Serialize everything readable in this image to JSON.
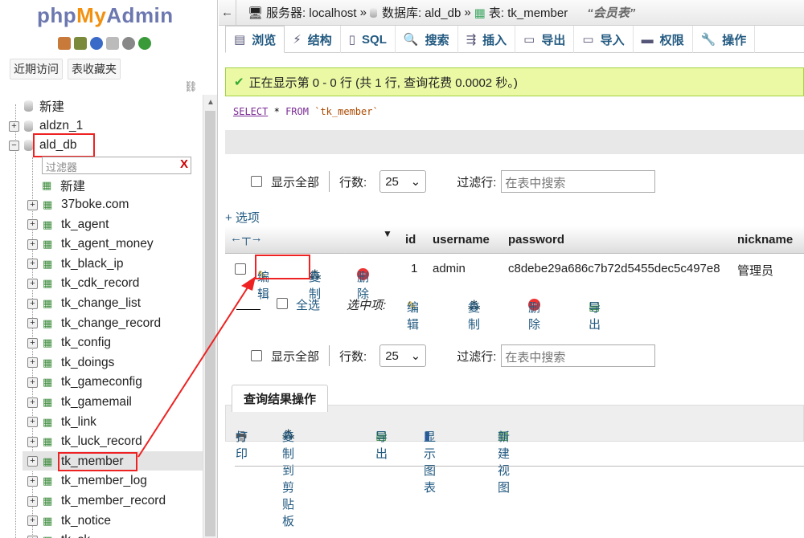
{
  "logo": {
    "php": "php",
    "my": "My",
    "admin": "Admin"
  },
  "nav_tabs": {
    "recent": "近期访问",
    "favorites": "表收藏夹"
  },
  "tree": {
    "new_top": "新建",
    "db1": "aldzn_1",
    "db2": "ald_db",
    "filter_placeholder": "过滤器",
    "filter_clear": "X",
    "new_table": "新建",
    "tables": [
      "37boke.com",
      "tk_agent",
      "tk_agent_money",
      "tk_black_ip",
      "tk_cdk_record",
      "tk_change_list",
      "tk_change_record",
      "tk_config",
      "tk_doings",
      "tk_gameconfig",
      "tk_gamemail",
      "tk_link",
      "tk_luck_record",
      "tk_member",
      "tk_member_log",
      "tk_member_record",
      "tk_notice",
      "tk_sk..."
    ],
    "selected_table": "tk_member"
  },
  "breadcrumb": {
    "server_label": "服务器: localhost",
    "sep": "»",
    "db_label": "数据库: ald_db",
    "table_label": "表: tk_member",
    "comment": "“会员表”"
  },
  "tabs": [
    {
      "icon": "browse-icon",
      "label": "浏览"
    },
    {
      "icon": "structure-icon",
      "label": "结构"
    },
    {
      "icon": "sql-icon",
      "label": "SQL"
    },
    {
      "icon": "search-icon",
      "label": "搜索"
    },
    {
      "icon": "insert-icon",
      "label": "插入"
    },
    {
      "icon": "export-icon",
      "label": "导出"
    },
    {
      "icon": "import-icon",
      "label": "导入"
    },
    {
      "icon": "privileges-icon",
      "label": "权限"
    },
    {
      "icon": "operations-icon",
      "label": "操作"
    }
  ],
  "success_message": "正在显示第 0 - 0 行 (共 1 行, 查询花费 0.0002 秒。)",
  "sql": {
    "select": "SELECT",
    "star": "*",
    "from": "FROM",
    "table": "`tk_member`"
  },
  "paging": {
    "show_all": "显示全部",
    "rows_label": "行数:",
    "rows_value": "25",
    "filter_label": "过滤行:",
    "filter_placeholder": "在表中搜索"
  },
  "options_link": "+ 选项",
  "columns": [
    "id",
    "username",
    "password",
    "nickname"
  ],
  "row": {
    "edit": "编辑",
    "copy": "复制",
    "delete": "删除",
    "id": "1",
    "username": "admin",
    "password": "c8debe29a686c7b72d5455dec5c497e8",
    "nickname": "管理员"
  },
  "bulk": {
    "check_all": "全选",
    "with_selected": "选中项:",
    "edit": "编辑",
    "copy": "复制",
    "delete": "删除",
    "export": "导出"
  },
  "query_ops": {
    "title": "查询结果操作",
    "print": "打印",
    "copy_clipboard": "复制到剪贴板",
    "export": "导出",
    "chart": "显示图表",
    "new_view": "新建视图"
  },
  "colors": {
    "accent": "#235a81",
    "success_bg": "#ebf8a4",
    "highlight": "#e22222"
  }
}
